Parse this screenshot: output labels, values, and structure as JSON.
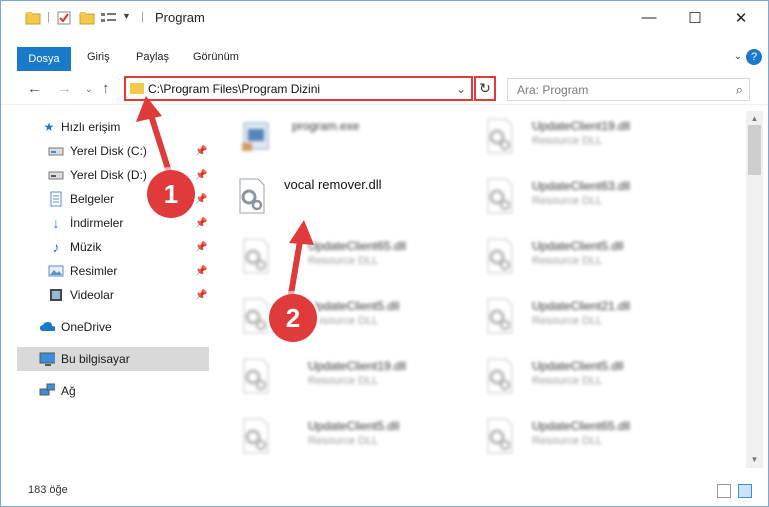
{
  "window": {
    "title": "Program",
    "controls": {
      "minimize": "—",
      "maximize": "☐",
      "close": "✕"
    }
  },
  "ribbon": {
    "tabs": [
      "Dosya",
      "Giriş",
      "Paylaş",
      "Görünüm"
    ],
    "active_tab": "Dosya",
    "help": "?"
  },
  "nav": {
    "address": "C:\\Program Files\\Program Dizini",
    "search_placeholder": "Ara: Program"
  },
  "sidebar": {
    "items": [
      {
        "label": "Hızlı erişim",
        "icon": "star-icon",
        "pinned": false
      },
      {
        "label": "Yerel Disk (C:)",
        "icon": "drive-icon",
        "pinned": true
      },
      {
        "label": "Yerel Disk (D:)",
        "icon": "drive-icon",
        "pinned": true
      },
      {
        "label": "Belgeler",
        "icon": "document-icon",
        "pinned": true
      },
      {
        "label": "İndirmeler",
        "icon": "download-icon",
        "pinned": true
      },
      {
        "label": "Müzik",
        "icon": "music-icon",
        "pinned": true
      },
      {
        "label": "Resimler",
        "icon": "image-icon",
        "pinned": true
      },
      {
        "label": "Videolar",
        "icon": "video-icon",
        "pinned": true
      },
      {
        "label": "OneDrive",
        "icon": "cloud-icon",
        "pinned": false
      },
      {
        "label": "Bu bilgisayar",
        "icon": "computer-icon",
        "pinned": false,
        "selected": true
      },
      {
        "label": "Ağ",
        "icon": "network-icon",
        "pinned": false
      }
    ]
  },
  "files": {
    "left": [
      {
        "name": "program.exe",
        "type": ""
      },
      {
        "name": "vocal remover.dll",
        "type": ""
      },
      {
        "name": "UpdateClient65.dll",
        "type": "Resource DLL"
      },
      {
        "name": "UpdateClient5.dll",
        "type": "Resource DLL"
      },
      {
        "name": "UpdateClient19.dll",
        "type": "Resource DLL"
      },
      {
        "name": "UpdateClient5.dll",
        "type": "Resource DLL"
      }
    ],
    "right": [
      {
        "name": "UpdateClient19.dll",
        "type": "Resource DLL"
      },
      {
        "name": "UpdateClient63.dll",
        "type": "Resource DLL"
      },
      {
        "name": "UpdateClient5.dll",
        "type": "Resource DLL"
      },
      {
        "name": "UpdateClient21.dll",
        "type": "Resource DLL"
      },
      {
        "name": "UpdateClient5.dll",
        "type": "Resource DLL"
      },
      {
        "name": "UpdateClient65.dll",
        "type": "Resource DLL"
      }
    ]
  },
  "status": {
    "count": "183 öğe"
  },
  "annotations": {
    "step1": "1",
    "step2": "2"
  },
  "colors": {
    "accent": "#1979ca",
    "highlight": "#e03a3a",
    "folder": "#f3c94b"
  }
}
